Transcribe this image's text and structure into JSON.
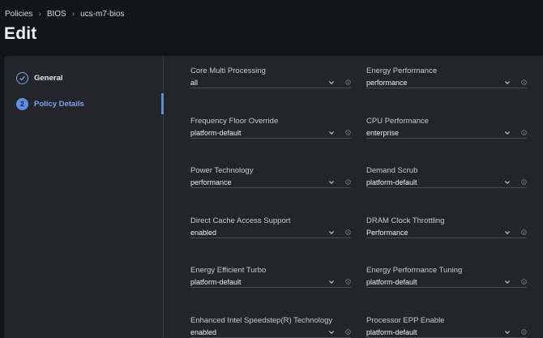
{
  "breadcrumb": {
    "items": [
      "Policies",
      "BIOS",
      "ucs-m7-bios"
    ]
  },
  "page": {
    "title": "Edit"
  },
  "steps": [
    {
      "label": "General",
      "state": "done"
    },
    {
      "number": "2",
      "label": "Policy Details",
      "state": "active"
    }
  ],
  "fields": [
    {
      "label": "Core Multi Processing",
      "value": "all"
    },
    {
      "label": "Energy Performance",
      "value": "performance"
    },
    {
      "label": "Frequency Floor Override",
      "value": "platform-default"
    },
    {
      "label": "CPU Performance",
      "value": "enterprise"
    },
    {
      "label": "Power Technology",
      "value": "performance"
    },
    {
      "label": "Demand Scrub",
      "value": "platform-default"
    },
    {
      "label": "Direct Cache Access Support",
      "value": "enabled"
    },
    {
      "label": "DRAM Clock Throttling",
      "value": "Performance"
    },
    {
      "label": "Energy Efficient Turbo",
      "value": "platform-default"
    },
    {
      "label": "Energy Performance Tuning",
      "value": "platform-default"
    },
    {
      "label": "Enhanced Intel Speedstep(R) Technology",
      "value": "enabled"
    },
    {
      "label": "Processor EPP Enable",
      "value": "platform-default"
    }
  ],
  "colors": {
    "accent": "#5b8fe6",
    "panel": "#23252b",
    "background": "#141518"
  },
  "icons": {
    "field_dropdown": "chevron-down-icon",
    "field_info": "info-icon",
    "step_done": "check-icon"
  }
}
